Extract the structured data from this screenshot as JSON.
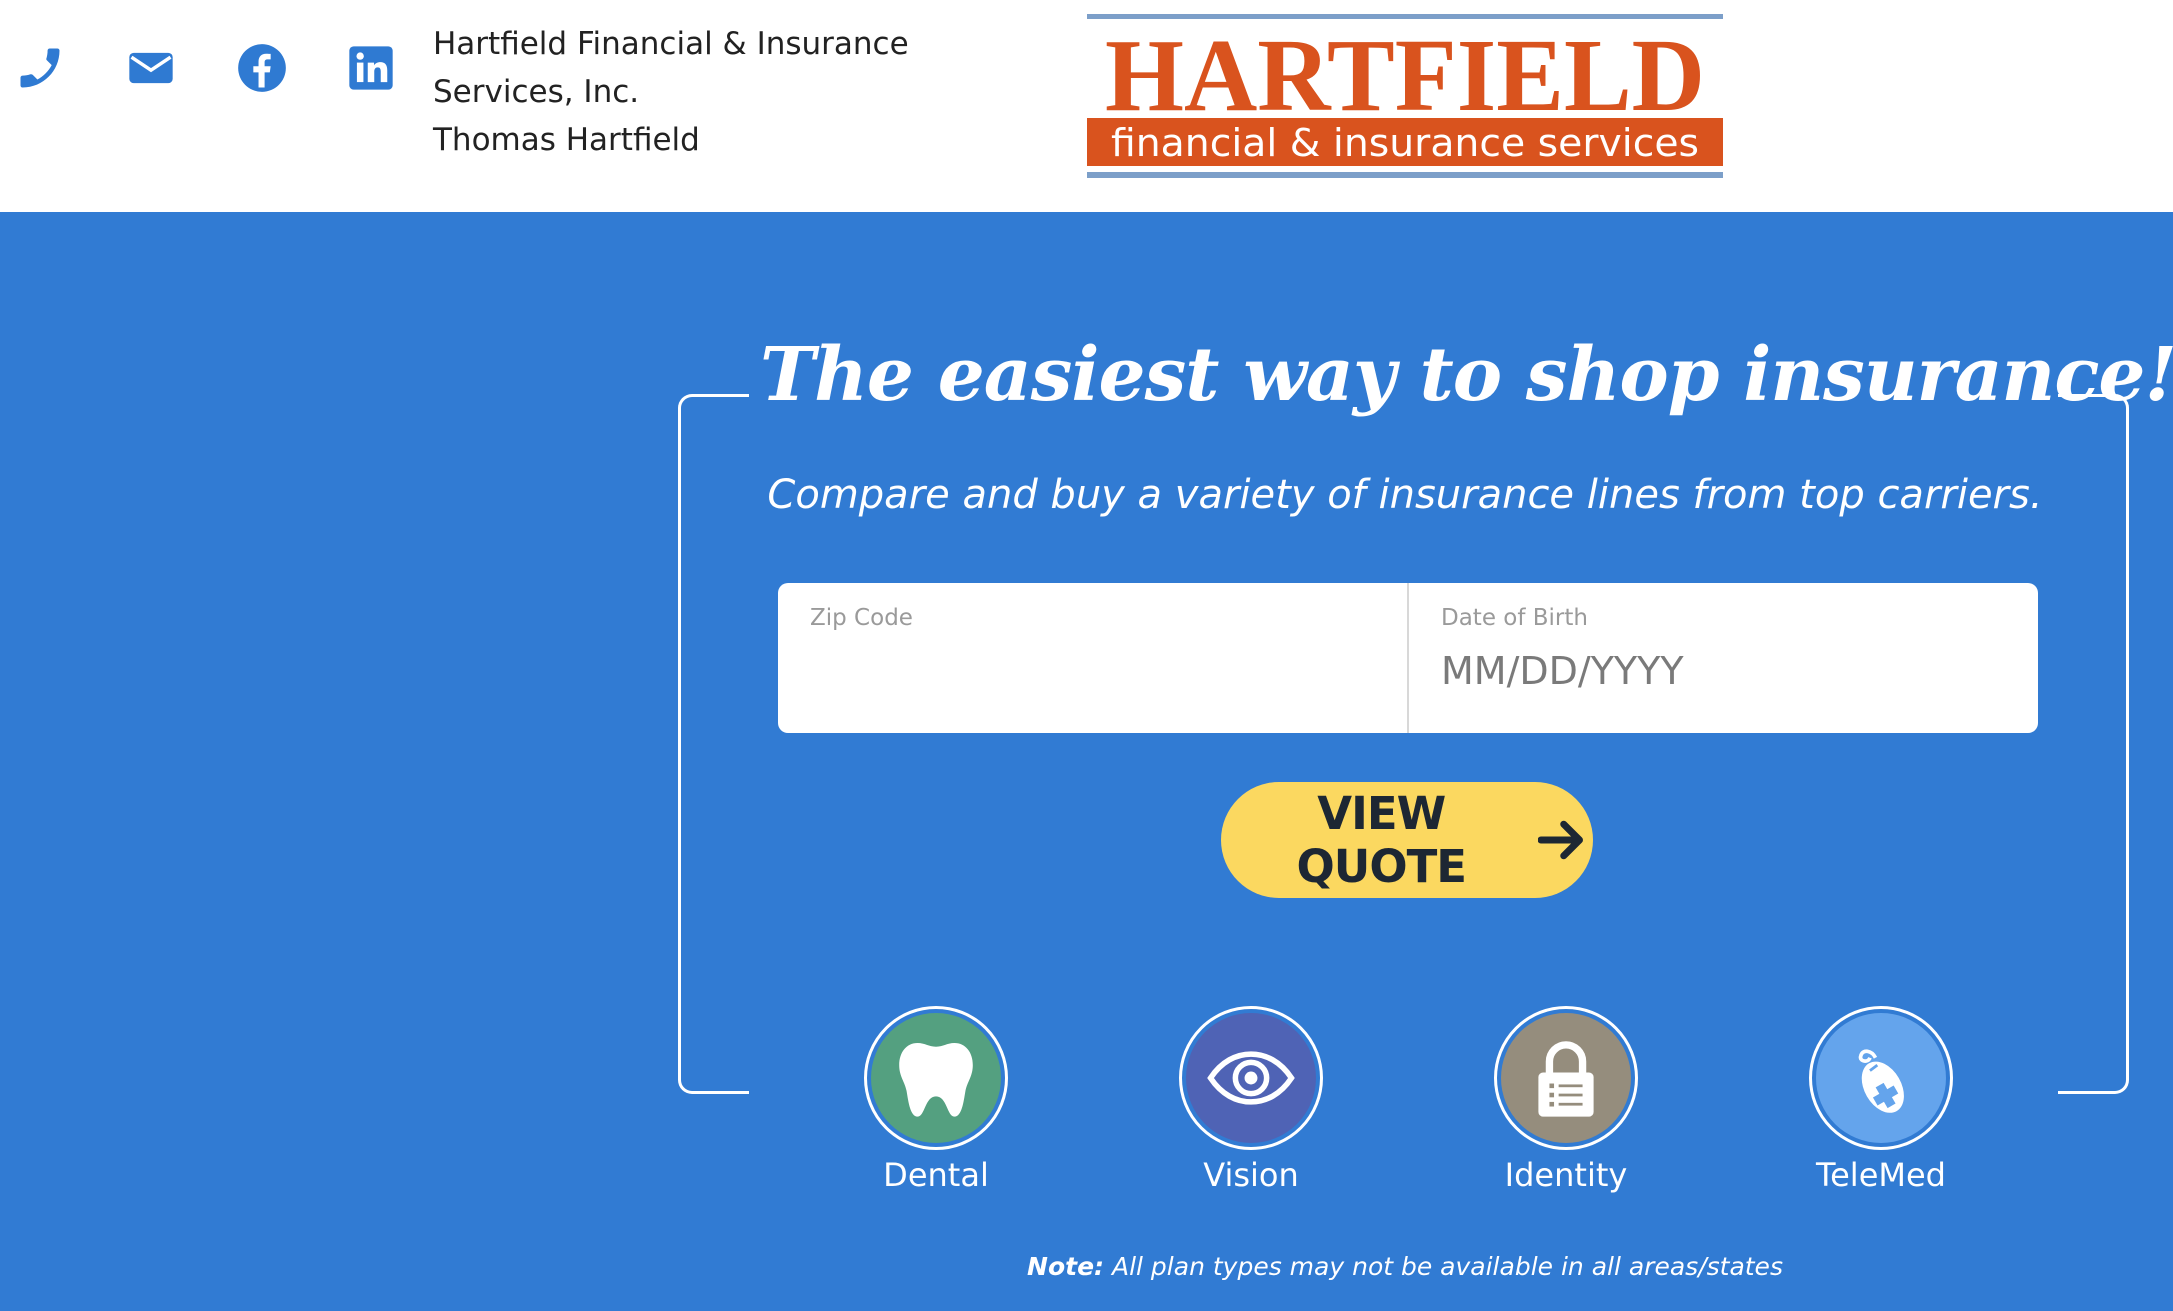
{
  "header": {
    "company_name_line1": "Hartfield Financial & Insurance",
    "company_name_line2": "Services, Inc.",
    "agent_name": "Thomas Hartfield",
    "contact_icons": [
      "phone-icon",
      "email-icon",
      "facebook-icon",
      "linkedin-icon"
    ],
    "icon_color": "#2f7ad2"
  },
  "logo": {
    "word": "HARTFIELD",
    "tagline": "financial & insurance services",
    "word_color": "#d9531e",
    "band_color": "#d9531e"
  },
  "hero": {
    "background": "#317bd3",
    "headline": "The easiest way to shop insurance!",
    "subhead": "Compare and buy a variety of insurance lines from top carriers."
  },
  "form": {
    "zip_label": "Zip Code",
    "zip_value": "",
    "zip_placeholder": "",
    "dob_label": "Date of Birth",
    "dob_value": "",
    "dob_placeholder": "MM/DD/YYYY"
  },
  "cta": {
    "label": "VIEW QUOTE",
    "icon": "arrow-right-icon",
    "color": "#fbd860"
  },
  "products": [
    {
      "label": "Dental",
      "icon": "tooth-icon",
      "color": "#54a080"
    },
    {
      "label": "Vision",
      "icon": "eye-icon",
      "color": "#4f63b5"
    },
    {
      "label": "Identity",
      "icon": "lock-icon",
      "color": "#958d7d"
    },
    {
      "label": "TeleMed",
      "icon": "mouse-icon",
      "color": "#64a4ec"
    }
  ],
  "note": {
    "prefix": "Note:",
    "text": " All plan types may not be available in all areas/states"
  }
}
